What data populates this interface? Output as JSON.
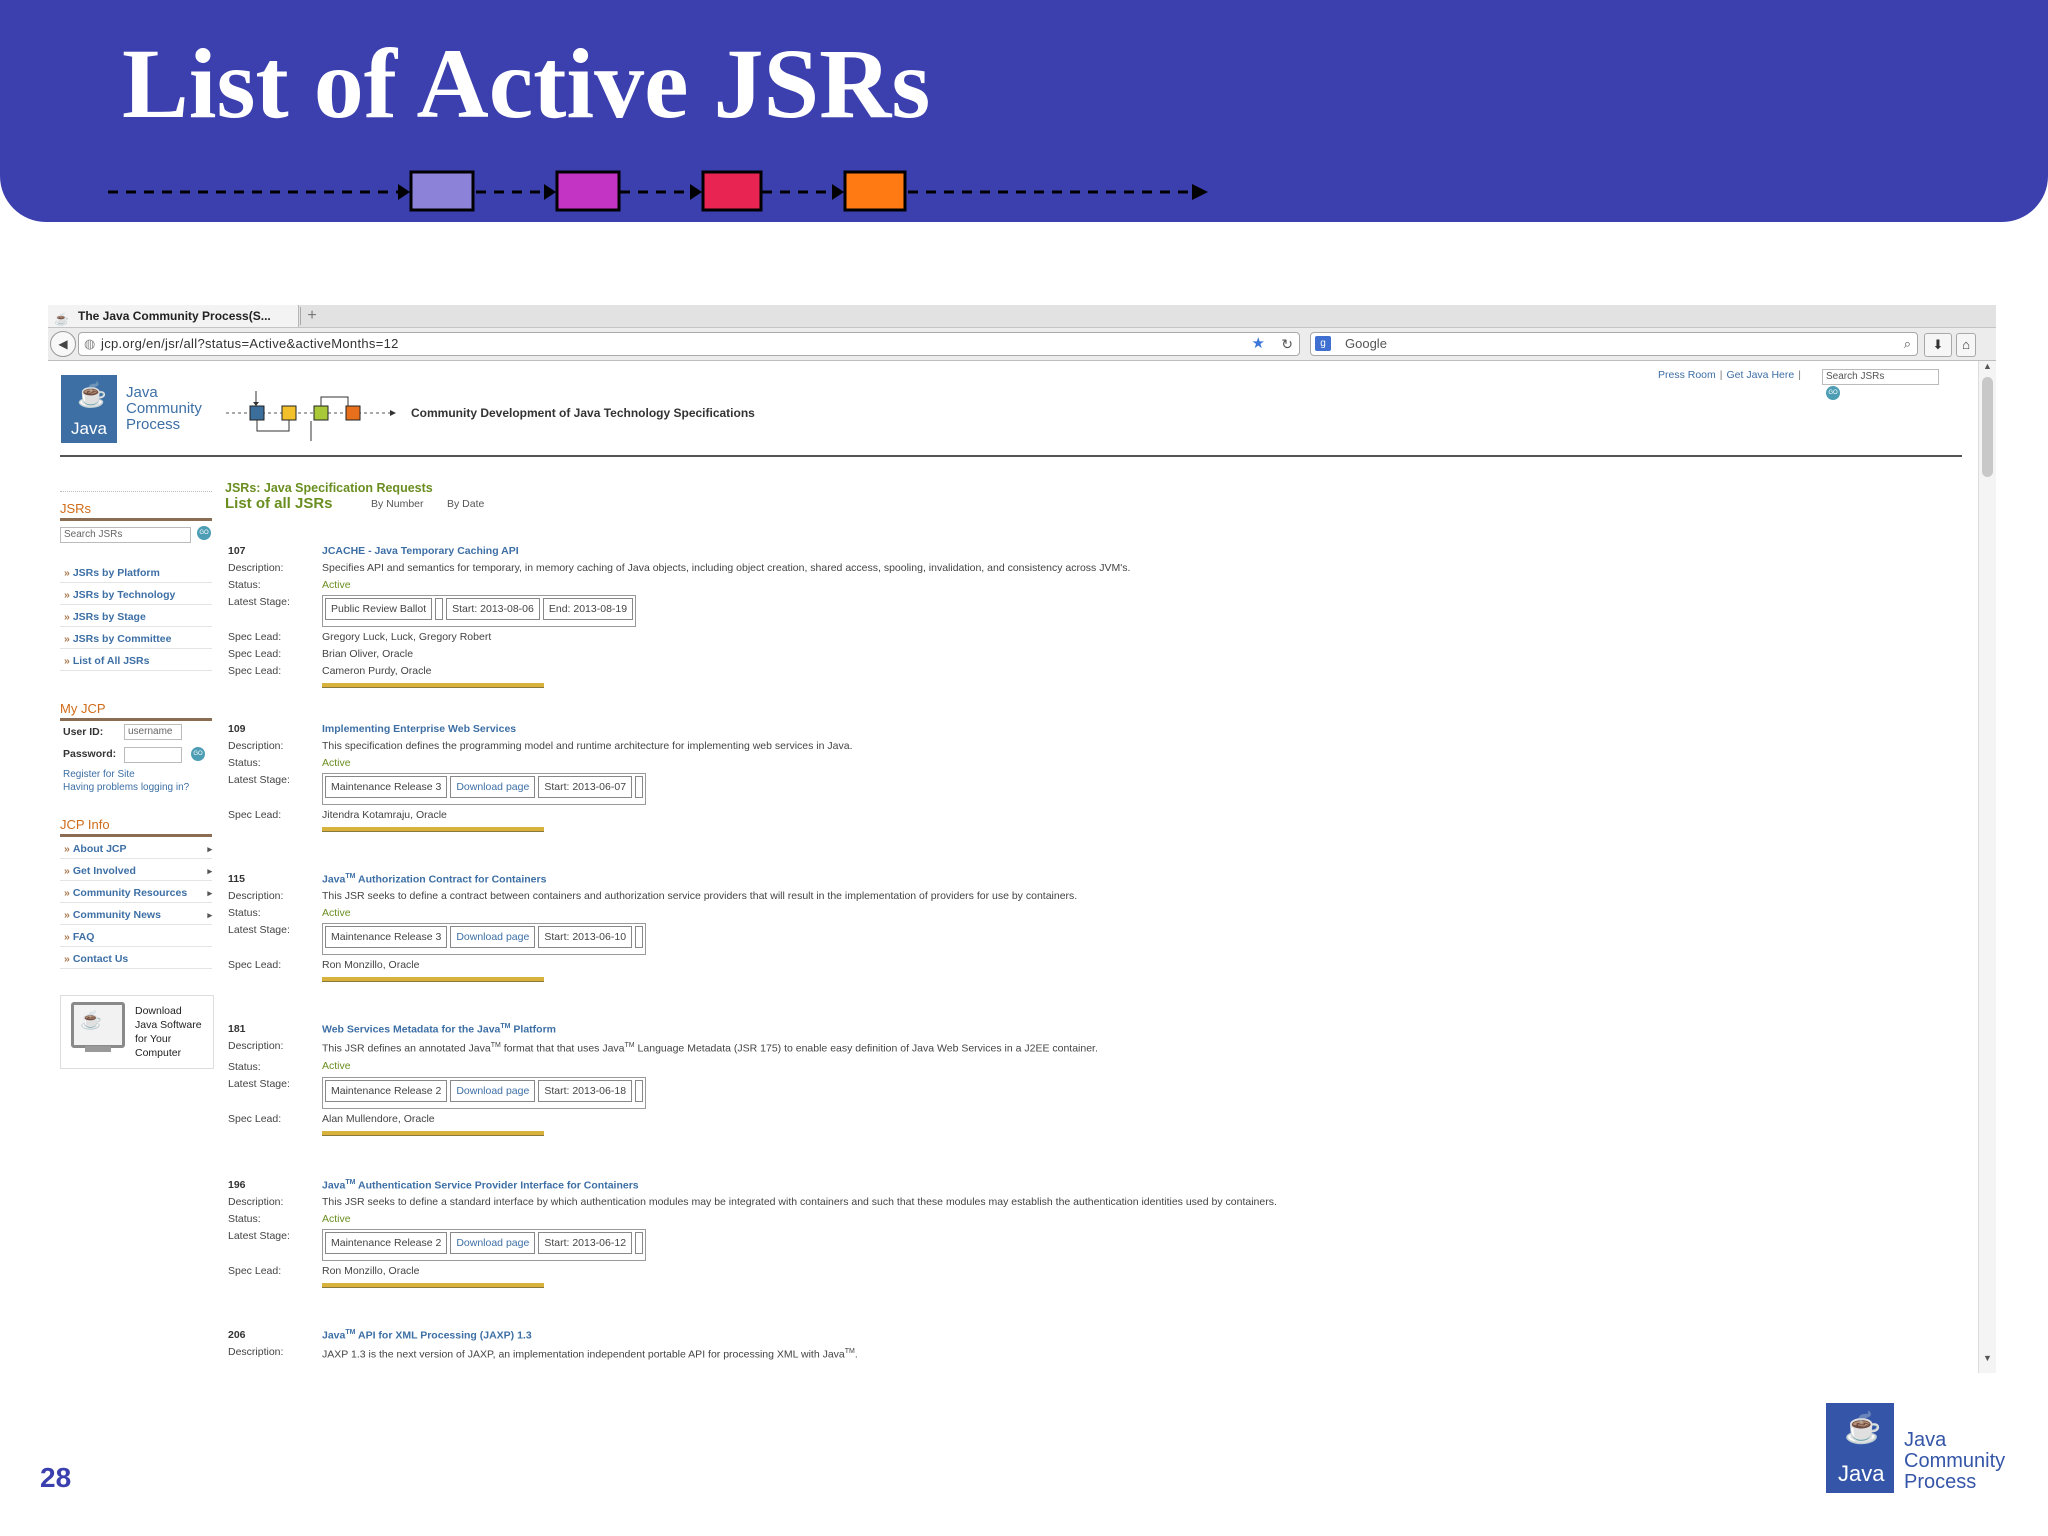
{
  "slide": {
    "title": "List of Active JSRs",
    "page_number": "28",
    "flow_colors": [
      "#8c82d8",
      "#c333c4",
      "#e82552",
      "#ff7a12"
    ]
  },
  "browser": {
    "tab_title": "The Java Community Process(S...",
    "new_tab": "+",
    "url": "jcp.org/en/jsr/all?status=Active&activeMonths=12",
    "search_engine": "Google"
  },
  "site": {
    "logo_word": "Java",
    "name": [
      "Java",
      "Community",
      "Process"
    ],
    "tagline": "Community Development of Java Technology Specifications",
    "top_links": [
      "Press Room",
      "Get Java Here"
    ],
    "top_search_placeholder": "Search JSRs",
    "go": "GO"
  },
  "leftnav": {
    "jsrs_heading": "JSRs",
    "search_placeholder": "Search JSRs",
    "jsr_links": [
      "JSRs by Platform",
      "JSRs by Technology",
      "JSRs by Stage",
      "JSRs by Committee",
      "List of All JSRs"
    ],
    "myjcp_heading": "My JCP",
    "user_id_label": "User ID:",
    "user_id_placeholder": "username",
    "password_label": "Password:",
    "register_link": "Register for Site",
    "problems_link": "Having problems logging in?",
    "info_heading": "JCP Info",
    "info_links": [
      "About JCP",
      "Get Involved",
      "Community Resources",
      "Community News",
      "FAQ",
      "Contact Us"
    ],
    "download_text": [
      "Download",
      "Java Software",
      "for Your",
      "Computer"
    ]
  },
  "main": {
    "subtitle": "JSRs: Java Specification Requests",
    "title": "List of all JSRs",
    "by_number": "By Number",
    "by_date": "By Date",
    "labels": {
      "description": "Description:",
      "status": "Status:",
      "latest_stage": "Latest Stage:",
      "spec_lead": "Spec Lead:"
    },
    "tm": "TM",
    "jsrs": [
      {
        "number": "107",
        "title": "JCACHE - Java Temporary Caching API",
        "description": "Specifies API and semantics for temporary, in memory caching of Java objects, including object creation, shared access, spooling, invalidation, and consistency across JVM's.",
        "status": "Active",
        "stage": "Public Review Ballot",
        "start": "Start: 2013-08-06",
        "end": "End: 2013-08-19",
        "leads": [
          "Gregory Luck, Luck, Gregory Robert",
          "Brian Oliver, Oracle",
          "Cameron Purdy, Oracle"
        ]
      },
      {
        "number": "109",
        "title": "Implementing Enterprise Web Services",
        "description": "This specification defines the programming model and runtime architecture for implementing web services in Java.",
        "status": "Active",
        "stage": "Maintenance Release 3",
        "download": "Download page",
        "start": "Start: 2013-06-07",
        "leads": [
          "Jitendra Kotamraju, Oracle"
        ]
      },
      {
        "number": "115",
        "title_pre": "Java",
        "title_post": " Authorization Contract for Containers",
        "description": "This JSR seeks to define a contract between containers and authorization service providers that will result in the implementation of providers for use by containers.",
        "status": "Active",
        "stage": "Maintenance Release 3",
        "download": "Download page",
        "start": "Start: 2013-06-10",
        "leads": [
          "Ron Monzillo, Oracle"
        ]
      },
      {
        "number": "181",
        "title_pre": "Web Services Metadata for the Java",
        "title_post": " Platform",
        "desc_a": "This JSR defines an annotated Java",
        "desc_b": " format that that uses Java",
        "desc_c": " Language Metadata (JSR 175) to enable easy definition of Java Web Services in a J2EE container.",
        "status": "Active",
        "stage": "Maintenance Release 2",
        "download": "Download page",
        "start": "Start: 2013-06-18",
        "leads": [
          "Alan Mullendore, Oracle"
        ]
      },
      {
        "number": "196",
        "title_pre": "Java",
        "title_post": " Authentication Service Provider Interface for Containers",
        "description": "This JSR seeks to define a standard interface by which authentication modules may be integrated with containers and such that these modules may establish the authentication identities used by containers.",
        "status": "Active",
        "stage": "Maintenance Release 2",
        "download": "Download page",
        "start": "Start: 2013-06-12",
        "leads": [
          "Ron Monzillo, Oracle"
        ]
      },
      {
        "number": "206",
        "title_pre": "Java",
        "title_post": " API for XML Processing (JAXP) 1.3",
        "desc_a": "JAXP 1.3 is the next version of JAXP, an implementation independent portable API for processing XML with Java",
        "desc_b": "."
      }
    ]
  },
  "footer": {
    "logo_word": "Java",
    "name": [
      "Java",
      "Community",
      "Process"
    ]
  }
}
